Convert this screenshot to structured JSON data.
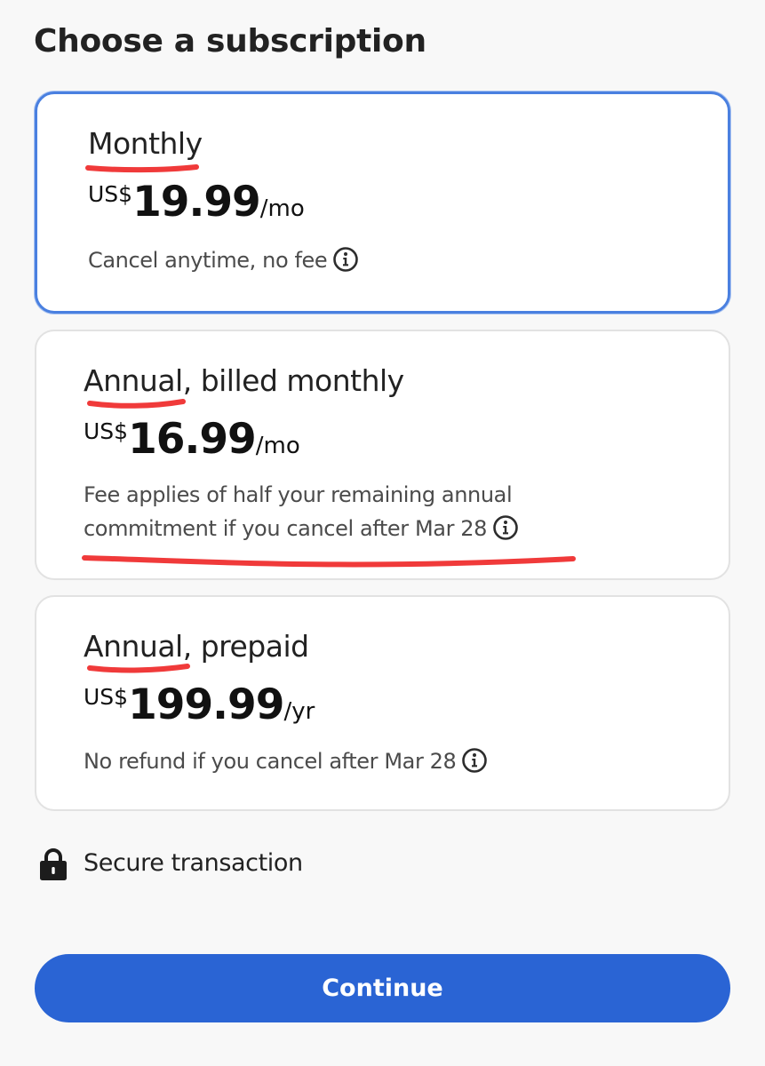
{
  "page": {
    "title": "Choose a subscription"
  },
  "plans": [
    {
      "name": "Monthly",
      "currency": "US$",
      "amount": "19.99",
      "period": "/mo",
      "description": "Cancel anytime, no fee",
      "selected": true
    },
    {
      "name": "Annual, billed monthly",
      "currency": "US$",
      "amount": "16.99",
      "period": "/mo",
      "description_line1": "Fee applies of half your remaining annual",
      "description_line2": "commitment if you cancel after Mar 28",
      "selected": false
    },
    {
      "name": "Annual, prepaid",
      "currency": "US$",
      "amount": "199.99",
      "period": "/yr",
      "description": "No refund if you cancel after Mar 28",
      "selected": false
    }
  ],
  "secure": {
    "label": "Secure transaction",
    "icon": "lock-icon"
  },
  "actions": {
    "continue_label": "Continue"
  },
  "icons": {
    "info": "info-icon"
  },
  "colors": {
    "accent": "#2a64d4",
    "selected_border": "#4a80e0",
    "annotation_red": "#f03a3a"
  }
}
